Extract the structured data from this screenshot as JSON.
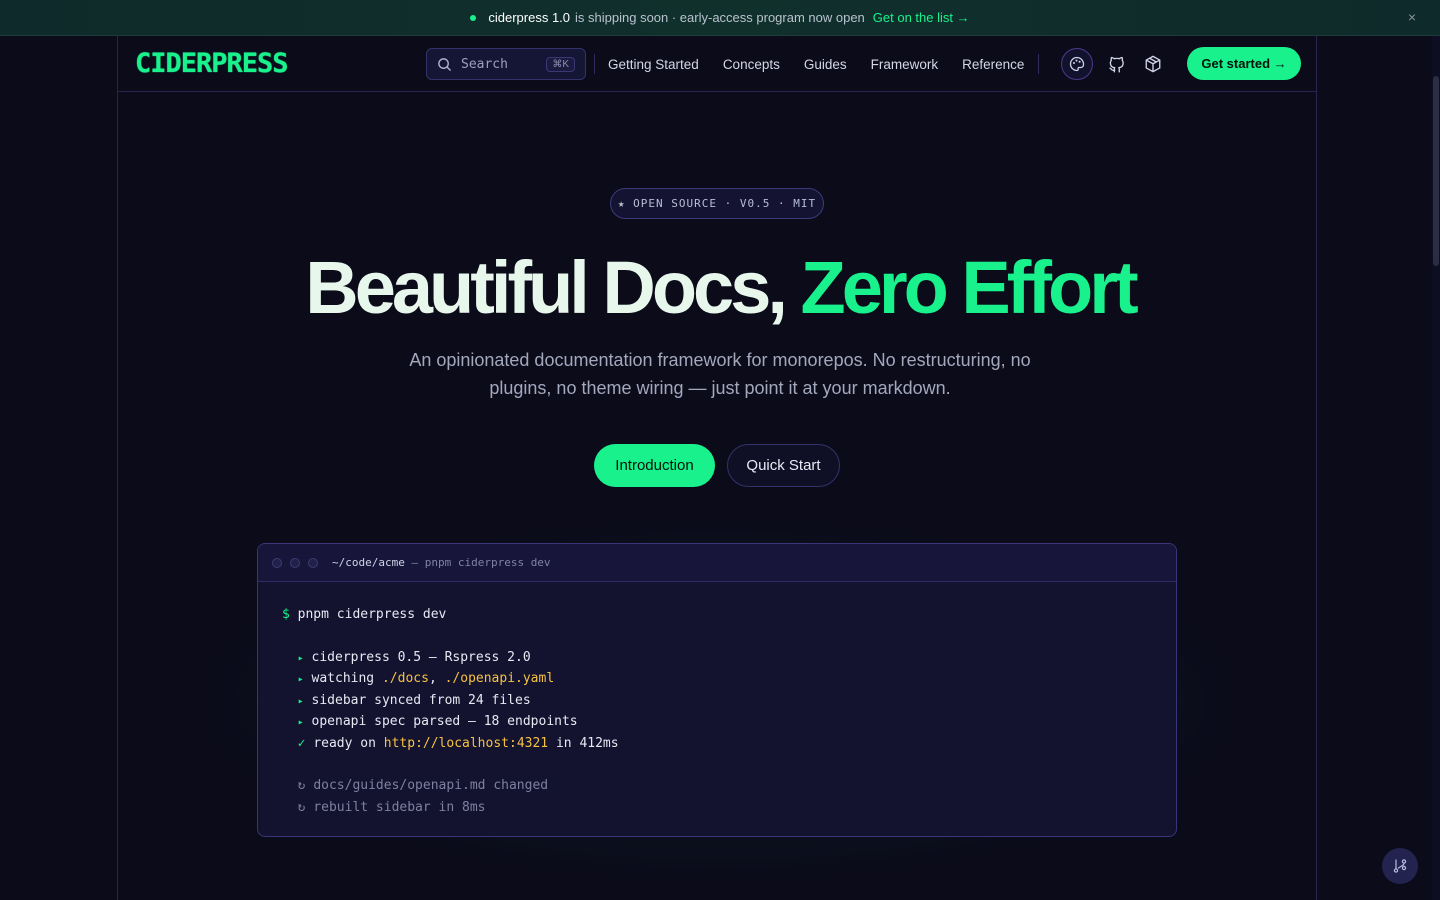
{
  "announcement": {
    "brand": "ciderpress 1.0",
    "message": "is shipping soon · early-access program now open",
    "link": "Get on the list →",
    "close": "×"
  },
  "nav": {
    "logo": "CIDERPRESS",
    "search_label": "Search",
    "search_shortcut": "⌘K",
    "links": [
      "Getting Started",
      "Concepts",
      "Guides",
      "Framework",
      "Reference"
    ],
    "cta": "Get started →"
  },
  "hero": {
    "pill": "★ OPEN SOURCE · V0.5 · MIT",
    "title_main": "Beautiful Docs, ",
    "title_accent": "Zero Effort",
    "subtitle": "An opinionated documentation framework for monorepos. No restructuring, no plugins, no theme wiring — just point it at your markdown.",
    "primary_button": "Introduction",
    "secondary_button": "Quick Start"
  },
  "terminal": {
    "path": "~/code/acme",
    "path_suffix": " — pnpm ciderpress dev",
    "prompt": "$",
    "command": "pnpm ciderpress dev",
    "lines": [
      {
        "marker": "▸",
        "text": "ciderpress 0.5 — Rspress 2.0"
      },
      {
        "marker": "▸",
        "pre": "watching ",
        "hl1": "./docs",
        "mid": ", ",
        "hl2": "./openapi.yaml"
      },
      {
        "marker": "▸",
        "text": "sidebar synced from 24 files"
      },
      {
        "marker": "▸",
        "text": "openapi spec parsed — 18 endpoints"
      },
      {
        "marker": "✓",
        "pre": "ready on ",
        "hl1": "http://localhost:4321",
        "post": " in 412ms"
      }
    ],
    "log": [
      {
        "marker": "↻",
        "text": "docs/guides/openapi.md changed"
      },
      {
        "marker": "↻",
        "text": "rebuilt sidebar in 8ms"
      }
    ]
  },
  "colors": {
    "accent": "#19f28c",
    "background": "#0b0b1a",
    "highlight": "#f5c242"
  }
}
